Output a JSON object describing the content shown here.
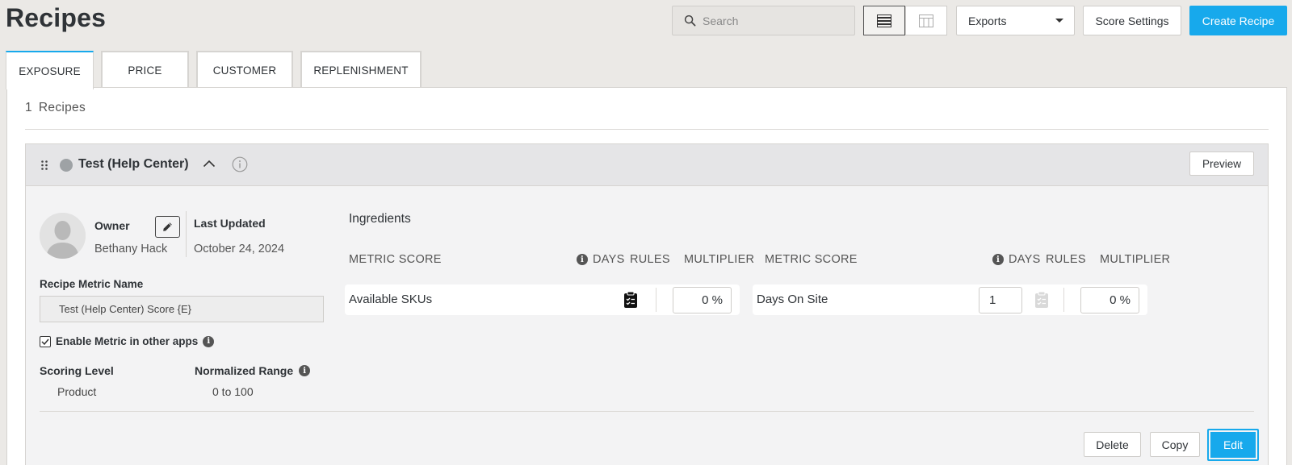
{
  "page": {
    "title": "Recipes"
  },
  "toolbar": {
    "search_placeholder": "Search",
    "exports_label": "Exports",
    "score_settings_label": "Score Settings",
    "create_recipe_label": "Create Recipe",
    "active_view": "list"
  },
  "tabs": [
    {
      "label": "EXPOSURE",
      "active": true
    },
    {
      "label": "PRICE",
      "active": false
    },
    {
      "label": "CUSTOMER",
      "active": false
    },
    {
      "label": "REPLENISHMENT",
      "active": false
    }
  ],
  "recipes": {
    "count": "1",
    "count_label": "Recipes"
  },
  "recipe": {
    "name": "Test (Help Center)",
    "preview_label": "Preview",
    "owner_label": "Owner",
    "owner_name": "Bethany Hack",
    "last_updated_label": "Last Updated",
    "last_updated_value": "October 24, 2024",
    "metric_name_label": "Recipe Metric Name",
    "metric_name_value": "Test (Help Center) Score {E}",
    "enable_label": "Enable Metric in other apps",
    "enable_checked": true,
    "scoring_level_label": "Scoring Level",
    "scoring_level_value": "Product",
    "normalized_range_label": "Normalized Range",
    "normalized_range_value": "0 to 100",
    "ingredients_title": "Ingredients",
    "columns": {
      "metric_score": "METRIC SCORE",
      "days": "DAYS",
      "rules": "RULES",
      "multiplier": "MULTIPLIER"
    },
    "ingredients": [
      {
        "name": "Available SKUs",
        "days": "",
        "multiplier": "0 %",
        "rules_active": true
      },
      {
        "name": "Days On Site",
        "days": "1",
        "multiplier": "0 %",
        "rules_active": false
      }
    ],
    "delete_label": "Delete",
    "copy_label": "Copy",
    "edit_label": "Edit"
  },
  "colors": {
    "accent": "#17a9ec",
    "background": "#ebe9e6",
    "status_dot": "#9ea2a5"
  }
}
